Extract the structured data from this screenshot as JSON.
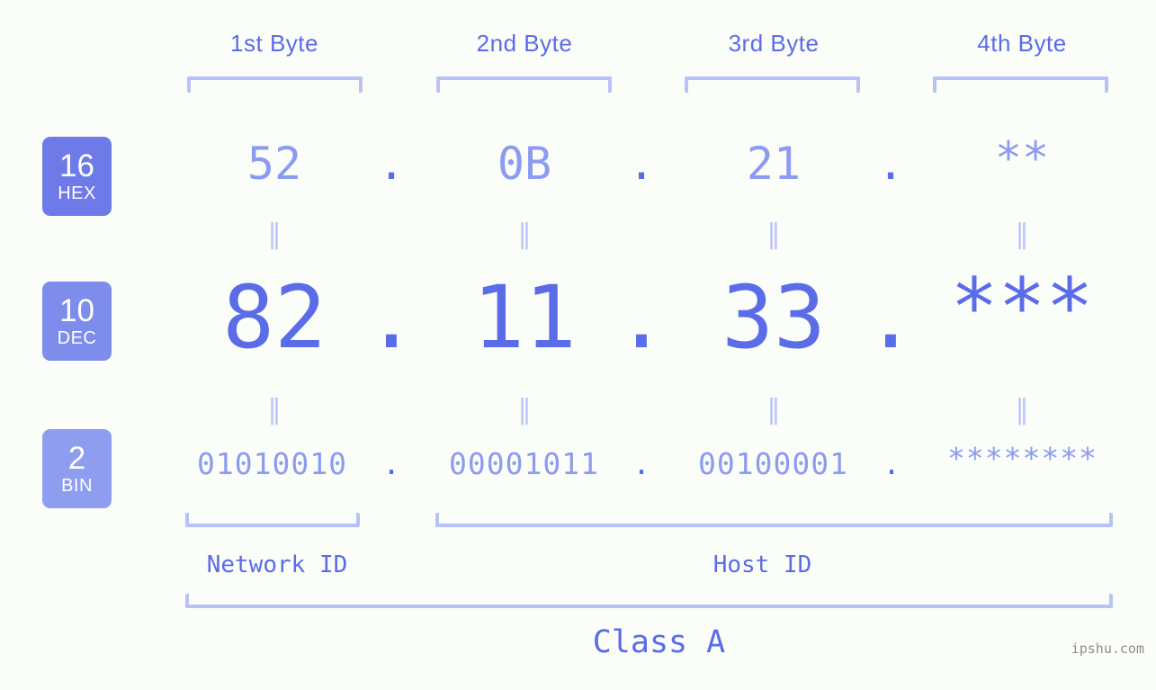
{
  "page": {
    "background_color": "#fbfdf8",
    "accent_color": "#5a6ce8",
    "accent_light_color": "#8c9bf0",
    "bracket_color": "#b9c2f7"
  },
  "byte_headers": [
    {
      "label": "1st Byte"
    },
    {
      "label": "2nd Byte"
    },
    {
      "label": "3rd Byte"
    },
    {
      "label": "4th Byte"
    }
  ],
  "bases": [
    {
      "num": "16",
      "name": "HEX",
      "color": "#6e7ae8"
    },
    {
      "num": "10",
      "name": "DEC",
      "color": "#7e8cec"
    },
    {
      "num": "2",
      "name": "BIN",
      "color": "#8f9df0"
    }
  ],
  "rows": {
    "hex": {
      "base_label": "HEX",
      "values": [
        "52",
        "0B",
        "21",
        "**"
      ],
      "separator": "."
    },
    "dec": {
      "base_label": "DEC",
      "values": [
        "82",
        "11",
        "33",
        "***"
      ],
      "separator": "."
    },
    "bin": {
      "base_label": "BIN",
      "values": [
        "01010010",
        "00001011",
        "00100001",
        "********"
      ],
      "separator": "."
    }
  },
  "equality_symbol": "‖",
  "segments": {
    "network_id": "Network ID",
    "host_id": "Host ID"
  },
  "class_label": "Class A",
  "watermark": "ipshu.com",
  "ip_summary": {
    "dotted_decimal": "82.11.33.***",
    "dotted_hex": "52.0B.21.**",
    "dotted_binary": "01010010.00001011.00100001.********",
    "class": "A"
  }
}
